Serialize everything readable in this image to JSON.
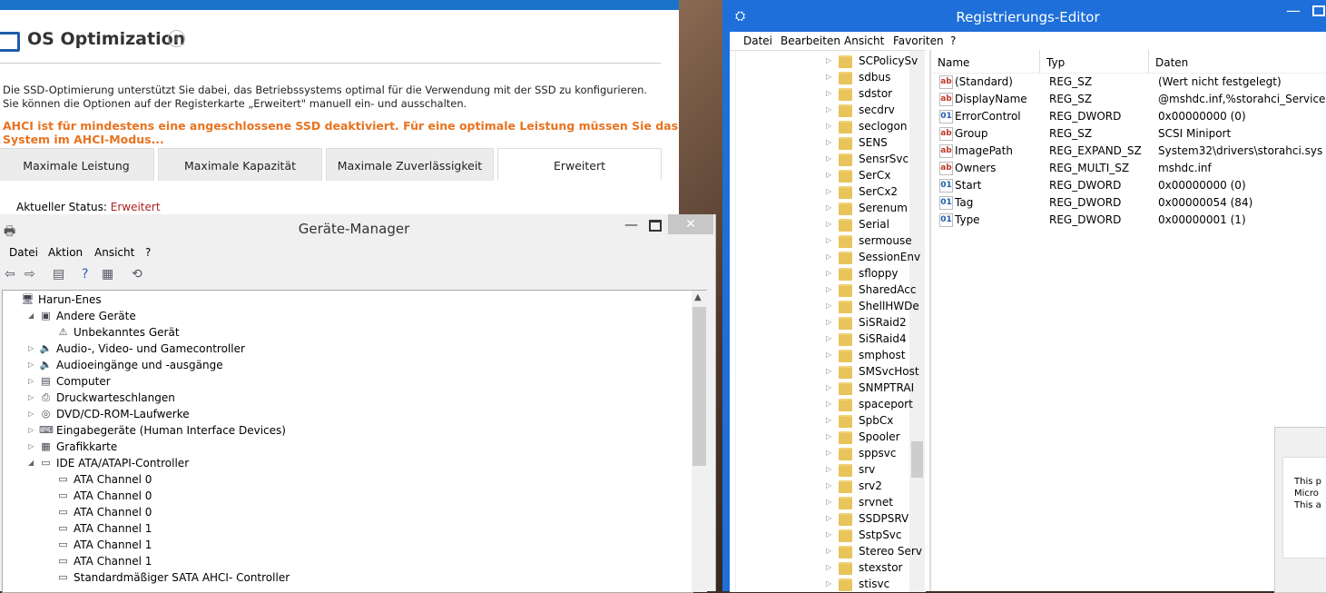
{
  "ssd": {
    "title": "OS Optimization",
    "help_symbol": "?",
    "desc_line1": "Die SSD-Optimierung unterstützt Sie dabei, das Betriebssystems optimal für die Verwendung mit der SSD zu konfigurieren.",
    "desc_line2": "Sie können die Optionen auf der Registerkarte „Erweitert\" manuell ein- und ausschalten.",
    "warning": "AHCI ist für mindestens eine angeschlossene SSD deaktiviert. Für eine optimale Leistung müssen Sie das System im AHCI-Modus...",
    "tabs": [
      "Maximale Leistung",
      "Maximale Kapazität",
      "Maximale Zuverlässigkeit",
      "Erweitert"
    ],
    "status_label": "Aktueller Status: ",
    "status_value": "Erweitert",
    "accent": "#e8731f"
  },
  "registry": {
    "title": "Registrierungs-Editor",
    "menu": [
      "Datei",
      "Bearbeiten",
      "Ansicht",
      "Favoriten",
      "?"
    ],
    "tree": [
      "SCPolicySv",
      "sdbus",
      "sdstor",
      "secdrv",
      "seclogon",
      "SENS",
      "SensrSvc",
      "SerCx",
      "SerCx2",
      "Serenum",
      "Serial",
      "sermouse",
      "SessionEnv",
      "sfloppy",
      "SharedAcc",
      "ShellHWDe",
      "SiSRaid2",
      "SiSRaid4",
      "smphost",
      "SMSvcHost",
      "SNMPTRAI",
      "spaceport",
      "SpbCx",
      "Spooler",
      "sppsvc",
      "srv",
      "srv2",
      "srvnet",
      "SSDPSRV",
      "SstpSvc",
      "Stereo Serv",
      "stexstor",
      "stisvc"
    ],
    "columns": [
      "Name",
      "Typ",
      "Daten"
    ],
    "values": [
      {
        "icon": "ab",
        "name": "(Standard)",
        "type": "REG_SZ",
        "data": "(Wert nicht festgelegt)"
      },
      {
        "icon": "ab",
        "name": "DisplayName",
        "type": "REG_SZ",
        "data": "@mshdc.inf,%storahci_ServiceDescr"
      },
      {
        "icon": "bin",
        "name": "ErrorControl",
        "type": "REG_DWORD",
        "data": "0x00000000 (0)"
      },
      {
        "icon": "ab",
        "name": "Group",
        "type": "REG_SZ",
        "data": "SCSI Miniport"
      },
      {
        "icon": "ab",
        "name": "ImagePath",
        "type": "REG_EXPAND_SZ",
        "data": "System32\\drivers\\storahci.sys"
      },
      {
        "icon": "ab",
        "name": "Owners",
        "type": "REG_MULTI_SZ",
        "data": "mshdc.inf"
      },
      {
        "icon": "bin",
        "name": "Start",
        "type": "REG_DWORD",
        "data": "0x00000000 (0)"
      },
      {
        "icon": "bin",
        "name": "Tag",
        "type": "REG_DWORD",
        "data": "0x00000054 (84)"
      },
      {
        "icon": "bin",
        "name": "Type",
        "type": "REG_DWORD",
        "data": "0x00000001 (1)"
      }
    ],
    "dialog_text": [
      "This p",
      "Micro",
      "This a"
    ],
    "accent": "#1e6fd9"
  },
  "devmgr": {
    "title": "Geräte-Manager",
    "menu": [
      "Datei",
      "Aktion",
      "Ansicht",
      "?"
    ],
    "close_symbol": "✕",
    "tree": [
      {
        "level": 0,
        "arrow": "",
        "icon": "computer-icon",
        "glyph": "🖥",
        "label": "Harun-Enes"
      },
      {
        "level": 1,
        "arrow": "◢",
        "icon": "unknown-device-icon",
        "glyph": "▣",
        "label": "Andere Geräte"
      },
      {
        "level": 2,
        "arrow": "",
        "icon": "warning-icon",
        "glyph": "⚠",
        "label": "Unbekanntes Gerät"
      },
      {
        "level": 1,
        "arrow": "▷",
        "icon": "speaker-icon",
        "glyph": "🔈",
        "label": "Audio-, Video- und Gamecontroller"
      },
      {
        "level": 1,
        "arrow": "▷",
        "icon": "speaker-icon",
        "glyph": "🔈",
        "label": "Audioeingänge und -ausgänge"
      },
      {
        "level": 1,
        "arrow": "▷",
        "icon": "computer-icon",
        "glyph": "▤",
        "label": "Computer"
      },
      {
        "level": 1,
        "arrow": "▷",
        "icon": "printer-icon",
        "glyph": "⎙",
        "label": "Druckwarteschlangen"
      },
      {
        "level": 1,
        "arrow": "▷",
        "icon": "disc-icon",
        "glyph": "◎",
        "label": "DVD/CD-ROM-Laufwerke"
      },
      {
        "level": 1,
        "arrow": "▷",
        "icon": "keyboard-icon",
        "glyph": "⌨",
        "label": "Eingabegeräte (Human Interface Devices)"
      },
      {
        "level": 1,
        "arrow": "▷",
        "icon": "display-icon",
        "glyph": "▦",
        "label": "Grafikkarte"
      },
      {
        "level": 1,
        "arrow": "◢",
        "icon": "controller-icon",
        "glyph": "▭",
        "label": "IDE ATA/ATAPI-Controller"
      },
      {
        "level": 2,
        "arrow": "",
        "icon": "controller-icon",
        "glyph": "▭",
        "label": "ATA Channel 0"
      },
      {
        "level": 2,
        "arrow": "",
        "icon": "controller-icon",
        "glyph": "▭",
        "label": "ATA Channel 0"
      },
      {
        "level": 2,
        "arrow": "",
        "icon": "controller-icon",
        "glyph": "▭",
        "label": "ATA Channel 0"
      },
      {
        "level": 2,
        "arrow": "",
        "icon": "controller-icon",
        "glyph": "▭",
        "label": "ATA Channel 1"
      },
      {
        "level": 2,
        "arrow": "",
        "icon": "controller-icon",
        "glyph": "▭",
        "label": "ATA Channel 1"
      },
      {
        "level": 2,
        "arrow": "",
        "icon": "controller-icon",
        "glyph": "▭",
        "label": "ATA Channel 1"
      },
      {
        "level": 2,
        "arrow": "",
        "icon": "controller-icon",
        "glyph": "▭",
        "label": "Standardmäßiger SATA AHCI- Controller"
      }
    ]
  }
}
